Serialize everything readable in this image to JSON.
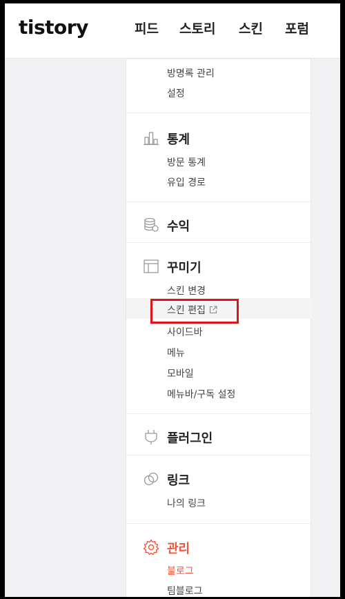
{
  "header": {
    "logo": "tistory",
    "nav": [
      "피드",
      "스토리",
      "스킨",
      "포럼"
    ]
  },
  "menu": {
    "prev_items": [
      "방명록 관리",
      "설정"
    ],
    "sections": [
      {
        "title": "통계",
        "icon": "bar-chart-icon",
        "items": [
          "방문 통계",
          "유입 경로"
        ]
      },
      {
        "title": "수익",
        "icon": "coins-icon",
        "items": []
      },
      {
        "title": "꾸미기",
        "icon": "layout-icon",
        "items": [
          "스킨 변경",
          "스킨 편집",
          "사이드바",
          "메뉴",
          "모바일",
          "메뉴바/구독 설정"
        ]
      },
      {
        "title": "플러그인",
        "icon": "plug-icon",
        "items": []
      },
      {
        "title": "링크",
        "icon": "link-icon",
        "items": [
          "나의 링크"
        ]
      },
      {
        "title": "관리",
        "icon": "gear-icon",
        "items": [
          "블로그",
          "팀블로그"
        ]
      }
    ]
  },
  "colors": {
    "accent": "#f0553a",
    "highlight_border": "#e0121b"
  }
}
